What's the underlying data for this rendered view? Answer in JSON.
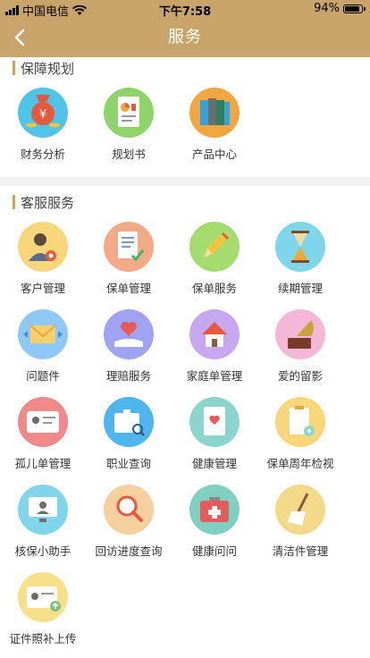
{
  "status_bar": {
    "carrier": "中国电信",
    "time": "下午7:58",
    "battery": "94%"
  },
  "nav": {
    "title": "服务"
  },
  "sections": [
    {
      "title": "保障规划",
      "items": [
        {
          "label": "财务分析",
          "icon": "money-bag-icon",
          "color": "#4fc3e8"
        },
        {
          "label": "规划书",
          "icon": "document-chart-icon",
          "color": "#8fd36b"
        },
        {
          "label": "产品中心",
          "icon": "binders-icon",
          "color": "#f2a640"
        }
      ]
    },
    {
      "title": "客服服务",
      "items": [
        {
          "label": "客户管理",
          "icon": "customer-gear-icon",
          "color": "#f7d77a"
        },
        {
          "label": "保单管理",
          "icon": "policy-check-icon",
          "color": "#f4a987"
        },
        {
          "label": "保单服务",
          "icon": "pencil-icon",
          "color": "#a5dc6f"
        },
        {
          "label": "续期管理",
          "icon": "hourglass-icon",
          "color": "#7fd6ea"
        },
        {
          "label": "问题件",
          "icon": "envelope-icon",
          "color": "#8fc8f5"
        },
        {
          "label": "理赔服务",
          "icon": "heart-hand-icon",
          "color": "#9fa3f2"
        },
        {
          "label": "家庭单管理",
          "icon": "house-icon",
          "color": "#c7a8f0"
        },
        {
          "label": "爱的留影",
          "icon": "gramophone-icon",
          "color": "#f3b7d8"
        },
        {
          "label": "孤儿单管理",
          "icon": "id-card-icon",
          "color": "#f08a8a"
        },
        {
          "label": "职业查询",
          "icon": "briefcase-search-icon",
          "color": "#4fb5ee"
        },
        {
          "label": "健康管理",
          "icon": "health-book-icon",
          "color": "#8ad6cf"
        },
        {
          "label": "保单周年检视",
          "icon": "clipboard-eye-icon",
          "color": "#f7d77a"
        },
        {
          "label": "核保小助手",
          "icon": "monitor-user-icon",
          "color": "#7fd6ea"
        },
        {
          "label": "回访进度查询",
          "icon": "magnifier-icon",
          "color": "#f6cf9e"
        },
        {
          "label": "健康问问",
          "icon": "medical-kit-icon",
          "color": "#7fd0c0"
        },
        {
          "label": "清洁件管理",
          "icon": "broom-icon",
          "color": "#f3d98a"
        },
        {
          "label": "证件照补上传",
          "icon": "id-upload-icon",
          "color": "#f7e08a"
        }
      ]
    }
  ]
}
